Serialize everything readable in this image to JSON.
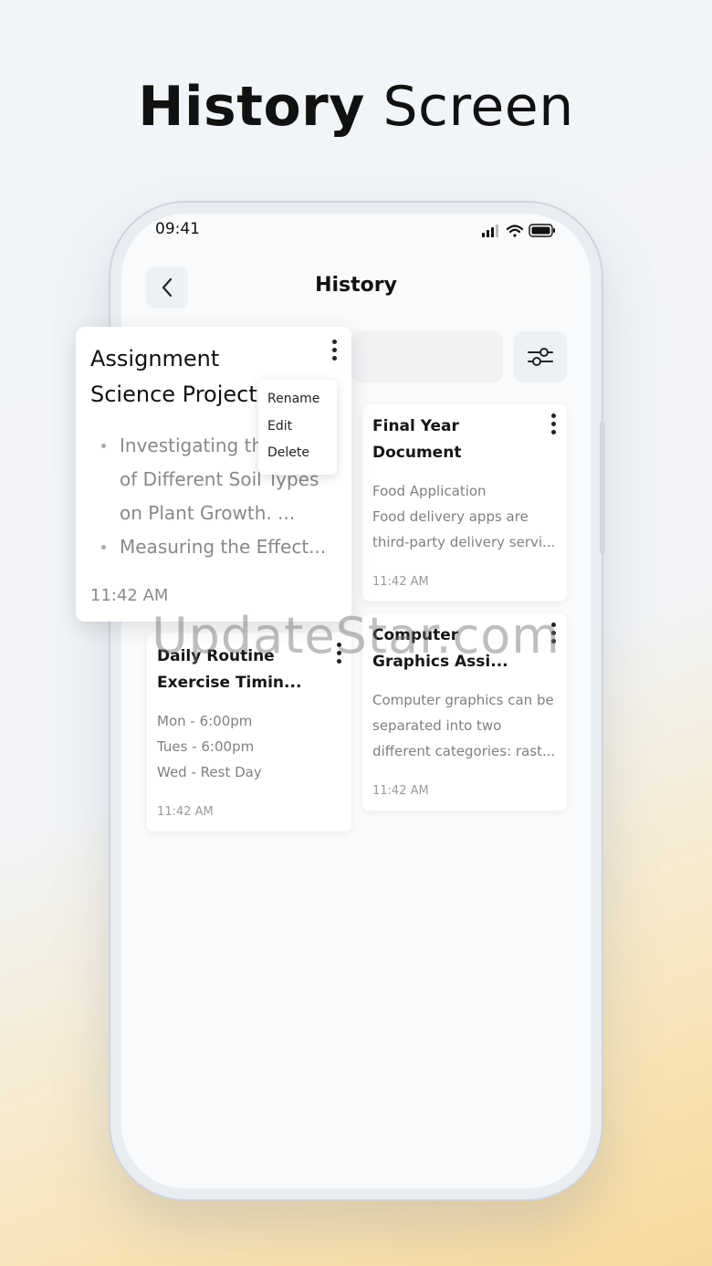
{
  "headline": {
    "bold": "History",
    "light": "Screen"
  },
  "status_bar": {
    "time": "09:41"
  },
  "nav": {
    "title": "History"
  },
  "expanded_card": {
    "title_line1": "Assignment",
    "title_line2": "Science Project",
    "bullet1_line1": "Investigating th",
    "bullet1_line2": "of Different Soil Types",
    "bullet1_line3": "on Plant Growth. ...",
    "bullet2": "Measuring the Effect...",
    "time": "11:42 AM"
  },
  "context_menu": {
    "items": [
      "Rename",
      "Edit",
      "Delete"
    ]
  },
  "cards": [
    {
      "title_line1": "Final Year",
      "title_line2": "Document",
      "body": [
        "Food Application",
        "Food delivery apps are",
        "third-party delivery servi..."
      ],
      "time": "11:42 AM"
    },
    {
      "title_line1": "Daily Routine",
      "title_line2": "Exercise Timin...",
      "body": [
        "Mon - 6:00pm",
        "Tues - 6:00pm",
        "Wed - Rest Day"
      ],
      "time": "11:42 AM"
    },
    {
      "title_line1": "Computer",
      "title_line2": "Graphics Assi...",
      "body": [
        "Computer graphics can be",
        "separated into two",
        "different categories: rast..."
      ],
      "time": "11:42 AM"
    }
  ],
  "watermark": "UpdateStar.com",
  "colors": {
    "accent_gold": "#f6d89c",
    "background": "#f1f4f8",
    "text": "#111111"
  },
  "icons": [
    "back-chevron-icon",
    "filter-sliders-icon",
    "kebab-menu-icon",
    "signal-icon",
    "wifi-icon",
    "battery-icon"
  ]
}
